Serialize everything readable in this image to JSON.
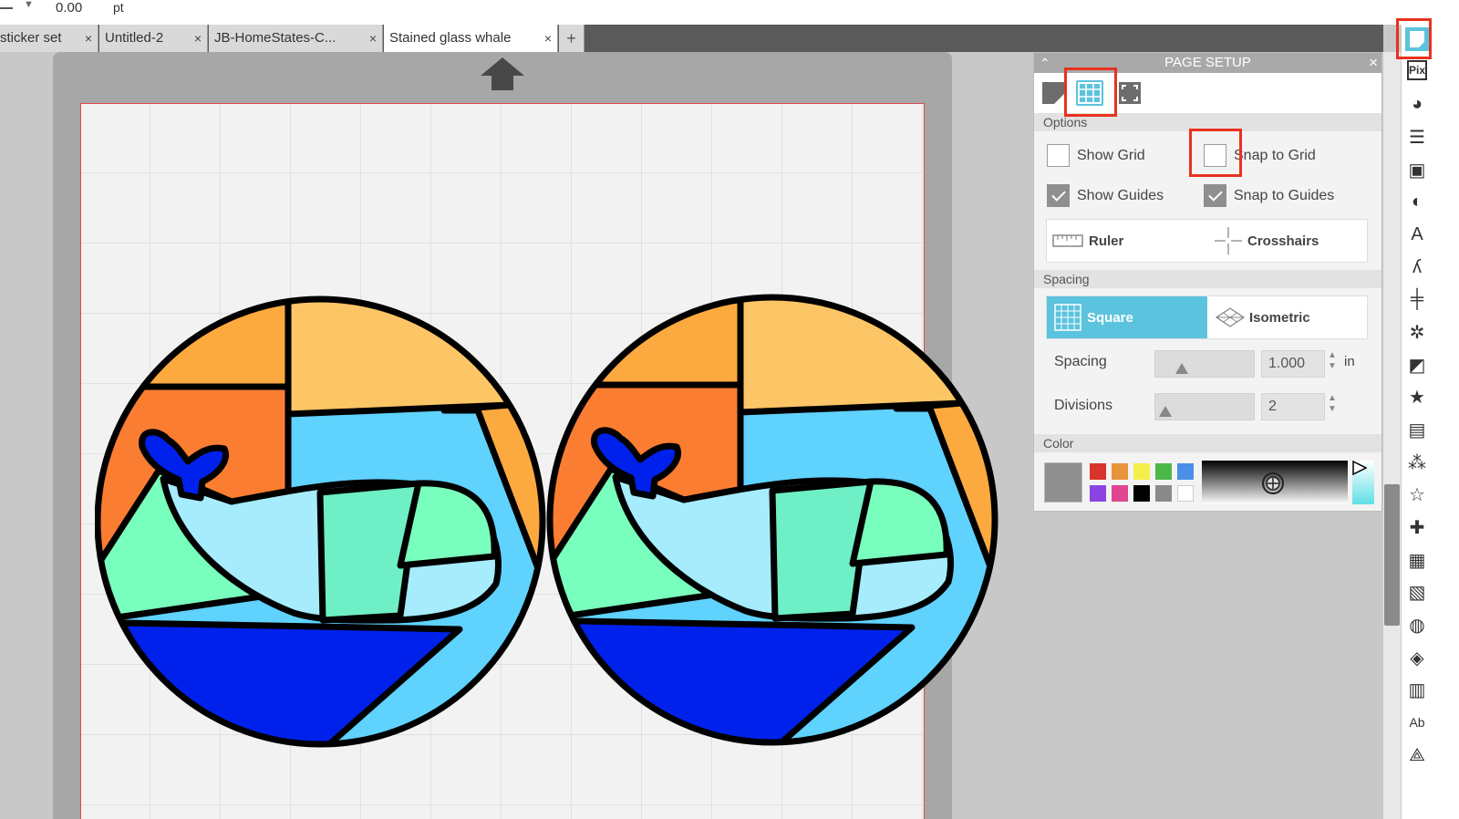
{
  "toolbar": {
    "value": "0.00",
    "unit": "pt"
  },
  "tabs": [
    {
      "label": "sticker set",
      "close": "×"
    },
    {
      "label": "Untitled-2",
      "close": "×"
    },
    {
      "label": "JB-HomeStates-C...",
      "close": "×"
    },
    {
      "label": "Stained glass whale",
      "close": "×"
    },
    {
      "label": "+"
    }
  ],
  "panel": {
    "title": "PAGE SETUP",
    "options_label": "Options",
    "show_grid": {
      "label": "Show Grid",
      "checked": false
    },
    "snap_to_grid": {
      "label": "Snap to Grid",
      "checked": false
    },
    "show_guides": {
      "label": "Show Guides",
      "checked": true
    },
    "snap_to_guides": {
      "label": "Snap to Guides",
      "checked": true
    },
    "ruler_label": "Ruler",
    "crosshairs_label": "Crosshairs",
    "spacing_label": "Spacing",
    "grid_type": {
      "square": "Square",
      "isometric": "Isometric",
      "selected": "Square"
    },
    "spacing": {
      "label": "Spacing",
      "value": "1.000",
      "unit": "in"
    },
    "divisions": {
      "label": "Divisions",
      "value": "2"
    },
    "color_label": "Color"
  },
  "colors": {
    "accent": "#5bc3de",
    "highlight": "#e8321f",
    "swatches": [
      "#d9342b",
      "#e8943a",
      "#f4ee4b",
      "#4cb84a",
      "#4a8fe8",
      "#8b44e3",
      "#e0468f",
      "#000000",
      "#8a8a8a",
      "#ffffff"
    ],
    "current": "#8f8f8f",
    "stained_glass": [
      "#fcc565",
      "#fca940",
      "#fb7d32",
      "#5fd2fd",
      "#a6ecfd",
      "#6eefc5",
      "#79ffbd",
      "#0021eb"
    ]
  },
  "right_icons": [
    "page-setup-icon",
    "pixscan-icon",
    "fill-icon",
    "line-icon",
    "image-icon",
    "contrast-icon",
    "text-icon",
    "sketch-icon",
    "align-icon",
    "replicate-icon",
    "transform-icon",
    "star-icon",
    "library-icon",
    "design-icon",
    "star-outline-icon",
    "puzzle-icon",
    "layers-icon",
    "texture-icon",
    "sphere-icon",
    "warp-icon",
    "map-icon",
    "font-icon",
    "crystal-icon"
  ]
}
